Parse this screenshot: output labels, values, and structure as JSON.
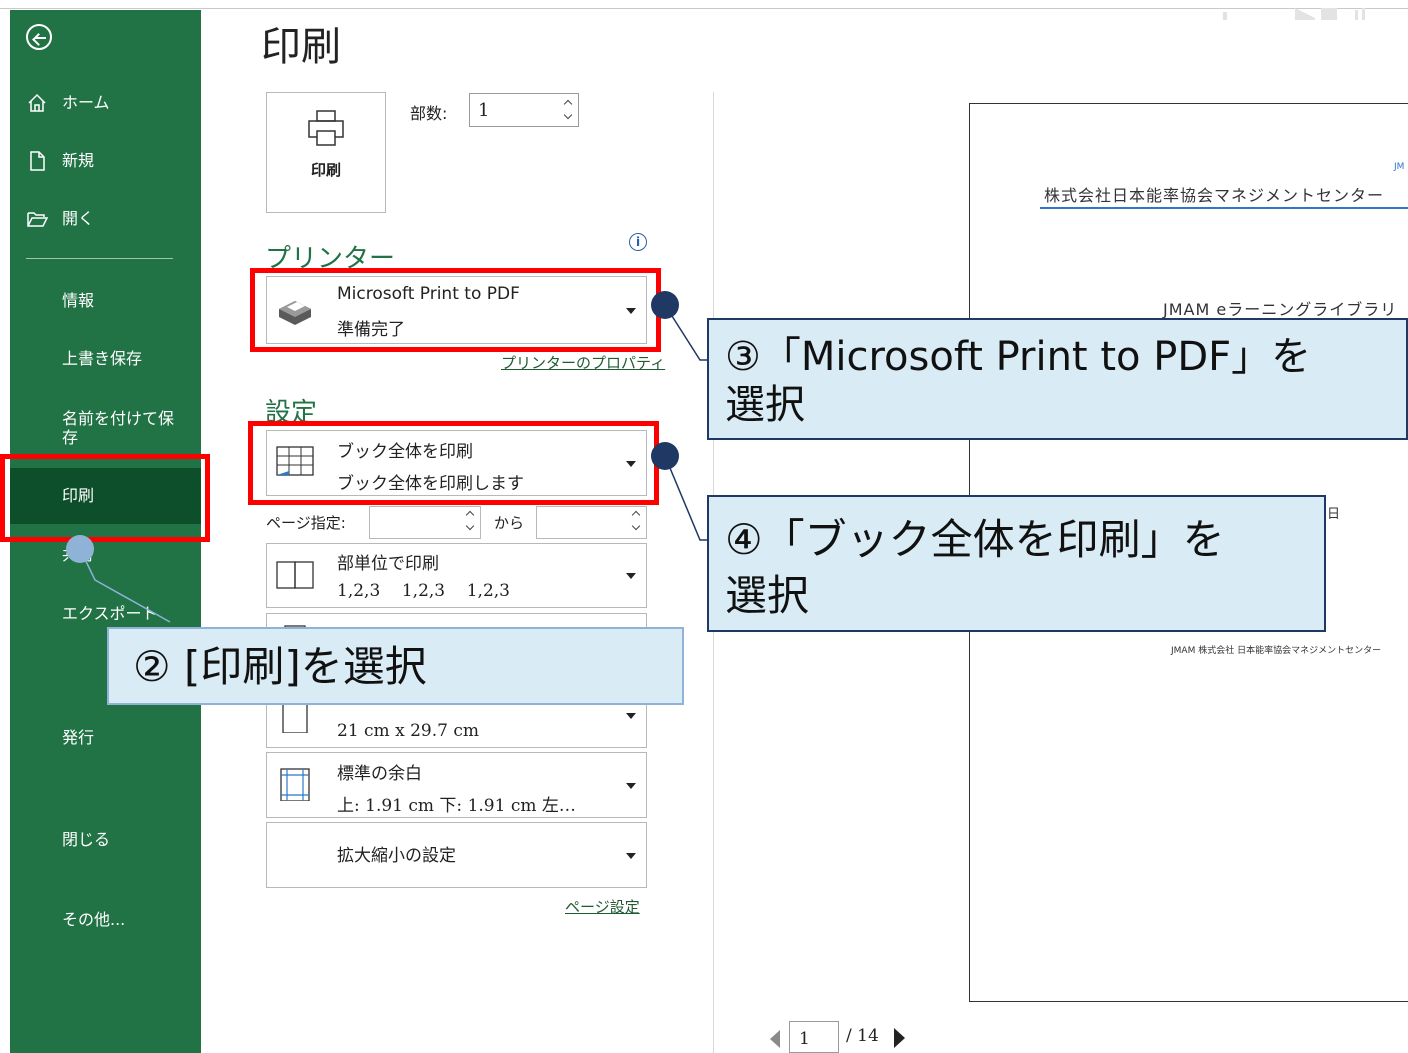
{
  "window": {
    "title": "印刷"
  },
  "sidebar": {
    "home": "ホーム",
    "new": "新規",
    "open": "開く",
    "info": "情報",
    "save": "上書き保存",
    "save_as": "名前を付けて保存",
    "print": "印刷",
    "share": "共有",
    "export": "エクスポート",
    "publish": "発行",
    "close": "閉じる",
    "more": "その他..."
  },
  "print": {
    "button_label": "印刷",
    "copies_label": "部数:",
    "copies_value": "1"
  },
  "printer": {
    "section_title": "プリンター",
    "name": "Microsoft Print to PDF",
    "status": "準備完了",
    "properties_link": "プリンターのプロパティ"
  },
  "settings": {
    "section_title": "設定",
    "scope_title": "ブック全体を印刷",
    "scope_desc": "ブック全体を印刷します",
    "pages_label": "ページ指定:",
    "pages_to_label": "から",
    "collate_title": "部単位で印刷",
    "collate_desc": "1,2,3    1,2,3    1,2,3",
    "paper_size": "21 cm x 29.7 cm",
    "margins_title": "標準の余白",
    "margins_desc": "上: 1.91 cm 下: 1.91 cm 左…",
    "scaling_title": "拡大縮小の設定",
    "page_setup_link": "ページ設定"
  },
  "preview": {
    "header_small": "JM",
    "company": "株式会社日本能率協会マネジメントセンター",
    "library": "JMAM eラーニングライブラリ",
    "day": "日",
    "footer": "JMAM 株式会社 日本能率協会マネジメントセンター",
    "current_page": "1",
    "total_pages": "/ 14"
  },
  "annotations": {
    "step2": "② [印刷]を選択",
    "step3_line1": "③「Microsoft Print to PDF」を",
    "step3_line2": "選択",
    "step4_line1": "④「ブック全体を印刷」を",
    "step4_line2": "選択"
  },
  "colors": {
    "sidebar_bg": "#217346",
    "sidebar_active": "#0d4f2a",
    "accent_green": "#217346",
    "highlight_red": "#ff0000",
    "callout_bg": "#d9ebf5",
    "callout_border": "#1f3864"
  }
}
